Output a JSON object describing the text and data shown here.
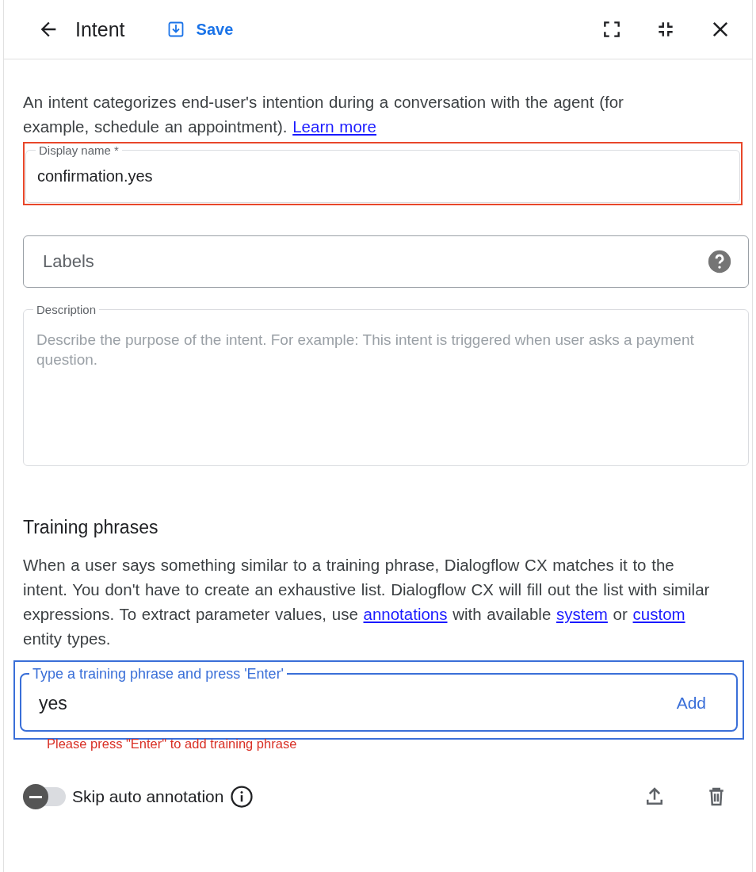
{
  "header": {
    "title": "Intent",
    "save_label": "Save"
  },
  "intro": [
    {
      "text": "An intent categorizes end-user's intention during a conversation with the agent (for example, schedule an appointment). ",
      "link": false
    },
    {
      "text": "Learn more",
      "link": true
    }
  ],
  "display_name": {
    "label": "Display name *",
    "value": "confirmation.yes",
    "highlighted": true
  },
  "labels": {
    "placeholder": "Labels"
  },
  "description": {
    "label": "Description",
    "placeholder": "Describe the purpose of the intent. For example: This intent is triggered when user asks a payment question."
  },
  "training": {
    "heading": "Training phrases",
    "text": [
      {
        "text": "When a user says something similar to a training phrase, Dialogflow CX matches it to the intent. You don't have to create an exhaustive list. Dialogflow CX will fill out the list with similar expressions. To extract parameter values, use ",
        "link": false
      },
      {
        "text": "annotations",
        "link": true
      },
      {
        "text": " with available ",
        "link": false
      },
      {
        "text": "system",
        "link": true
      },
      {
        "text": " or ",
        "link": false
      },
      {
        "text": "custom",
        "link": true
      },
      {
        "text": " entity types.",
        "link": false
      }
    ],
    "field": {
      "label": "Type a training phrase and press 'Enter'",
      "value": "yes",
      "add_label": "Add",
      "highlighted": true
    },
    "error": "Please press \"Enter\" to add training phrase",
    "skip_toggle": {
      "label": "Skip auto annotation",
      "on": false
    }
  }
}
